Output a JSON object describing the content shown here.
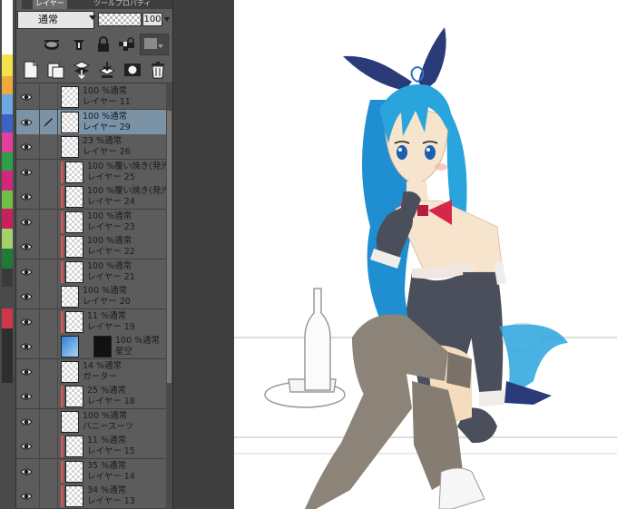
{
  "window": {
    "tabs": [
      {
        "label": "レイヤー",
        "active": true
      },
      {
        "label": "ツールプロパティ",
        "active": false
      }
    ]
  },
  "layer_panel": {
    "blend_mode": "通常",
    "opacity": "100",
    "layers": [
      {
        "opacity_mode": "100 %通常",
        "name": "レイヤー 11",
        "selected": false,
        "clipped": false,
        "editing": false
      },
      {
        "opacity_mode": "100 %通常",
        "name": "レイヤー 29",
        "selected": true,
        "clipped": false,
        "editing": true
      },
      {
        "opacity_mode": "23 %通常",
        "name": "レイヤー 26",
        "selected": false,
        "clipped": false,
        "editing": false
      },
      {
        "opacity_mode": "100 %覆い焼き(発光)",
        "name": "レイヤー 25",
        "selected": false,
        "clipped": true,
        "editing": false
      },
      {
        "opacity_mode": "100 %覆い焼き(発光)",
        "name": "レイヤー 24",
        "selected": false,
        "clipped": true,
        "editing": false
      },
      {
        "opacity_mode": "100 %通常",
        "name": "レイヤー 23",
        "selected": false,
        "clipped": true,
        "editing": false
      },
      {
        "opacity_mode": "100 %通常",
        "name": "レイヤー 22",
        "selected": false,
        "clipped": true,
        "editing": false
      },
      {
        "opacity_mode": "100 %通常",
        "name": "レイヤー 21",
        "selected": false,
        "clipped": true,
        "editing": false
      },
      {
        "opacity_mode": "100 %通常",
        "name": "レイヤー 20",
        "selected": false,
        "clipped": false,
        "editing": false
      },
      {
        "opacity_mode": "11 %通常",
        "name": "レイヤー 19",
        "selected": false,
        "clipped": true,
        "editing": false
      },
      {
        "opacity_mode": "100 %通常",
        "name": "星空",
        "selected": false,
        "clipped": false,
        "editing": false,
        "has_mask": true
      },
      {
        "opacity_mode": "14 %通常",
        "name": "ガーター",
        "selected": false,
        "clipped": false,
        "editing": false
      },
      {
        "opacity_mode": "25 %通常",
        "name": "レイヤー 18",
        "selected": false,
        "clipped": true,
        "editing": false
      },
      {
        "opacity_mode": "100 %通常",
        "name": "バニースーツ",
        "selected": false,
        "clipped": false,
        "editing": false
      },
      {
        "opacity_mode": "11 %通常",
        "name": "レイヤー 15",
        "selected": false,
        "clipped": true,
        "editing": false
      },
      {
        "opacity_mode": "35 %通常",
        "name": "レイヤー 14",
        "selected": false,
        "clipped": true,
        "editing": false
      },
      {
        "opacity_mode": "34 %通常",
        "name": "レイヤー 13",
        "selected": false,
        "clipped": true,
        "editing": false
      }
    ]
  },
  "colors": {
    "panel_bg": "#5c5c5c",
    "selected_row": "#7c93a6",
    "clip_indicator": "#c85a5a",
    "hair": "#2aa4dd",
    "bunny_ears": "#2b3a78",
    "suit": "#4b4f5c",
    "bowtie": "#d8264a",
    "stockings": "#8c8478",
    "skin": "#f7e2c8"
  },
  "icons": {
    "row1": [
      "palette-icon",
      "ruler-icon",
      "lock-icon",
      "lock-transparency-icon",
      "reference-layer-icon"
    ],
    "row2": [
      "new-raster-layer-icon",
      "new-folder-icon",
      "merge-down-icon",
      "merge-visible-icon",
      "mask-icon",
      "delete-layer-icon"
    ]
  }
}
